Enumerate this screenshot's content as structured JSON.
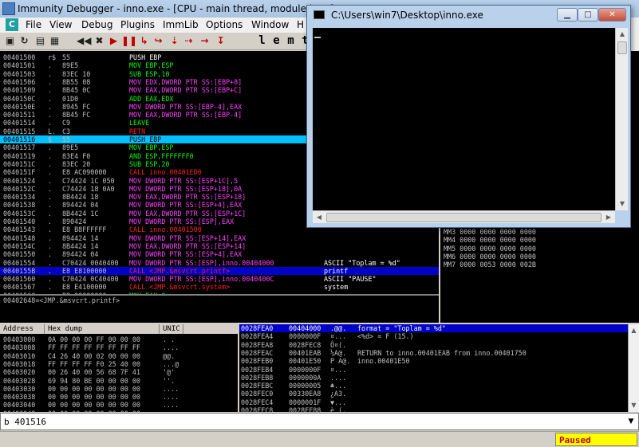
{
  "main_window": {
    "title": "Immunity Debugger - inno.exe - [CPU - main thread, module inno]",
    "menu": [
      "File",
      "View",
      "Debug",
      "Plugins",
      "ImmLib",
      "Options",
      "Window",
      "H"
    ],
    "menu_icon_letter": "C",
    "toolbar_letters": [
      "l",
      "e",
      "m",
      "t"
    ]
  },
  "disassembly": [
    {
      "addr": "00401500",
      "br": "r$",
      "hex": "55",
      "dis": "PUSH EBP",
      "com": "",
      "style": "white"
    },
    {
      "addr": "00401501",
      "br": ".",
      "hex": "89E5",
      "dis": "MOV EBP,ESP",
      "com": "",
      "style": "green"
    },
    {
      "addr": "00401503",
      "br": ".",
      "hex": "83EC 10",
      "dis": "SUB ESP,10",
      "com": "",
      "style": "green"
    },
    {
      "addr": "00401506",
      "br": ".",
      "hex": "8B55 08",
      "dis": "MOV EDX,DWORD PTR SS:[EBP+8]",
      "com": "",
      "style": "mem"
    },
    {
      "addr": "00401509",
      "br": ".",
      "hex": "8B45 0C",
      "dis": "MOV EAX,DWORD PTR SS:[EBP+C]",
      "com": "",
      "style": "mem"
    },
    {
      "addr": "0040150C",
      "br": ".",
      "hex": "01D0",
      "dis": "ADD EAX,EDX",
      "com": "",
      "style": "green"
    },
    {
      "addr": "0040150E",
      "br": ".",
      "hex": "8945 FC",
      "dis": "MOV DWORD PTR SS:[EBP-4],EAX",
      "com": "",
      "style": "mem"
    },
    {
      "addr": "00401511",
      "br": ".",
      "hex": "8B45 FC",
      "dis": "MOV EAX,DWORD PTR SS:[EBP-4]",
      "com": "",
      "style": "mem"
    },
    {
      "addr": "00401514",
      "br": ".",
      "hex": "C9",
      "dis": "LEAVE",
      "com": "",
      "style": "green"
    },
    {
      "addr": "00401515",
      "br": "L.",
      "hex": "C3",
      "dis": "RETN",
      "com": "",
      "style": "red"
    },
    {
      "addr": "00401516",
      "br": "$",
      "hex": "55",
      "dis": "PUSH EBP",
      "com": "",
      "style": "white",
      "hl": "cyan"
    },
    {
      "addr": "00401517",
      "br": ".",
      "hex": "89E5",
      "dis": "MOV EBP,ESP",
      "com": "",
      "style": "green"
    },
    {
      "addr": "00401519",
      "br": ".",
      "hex": "83E4 F0",
      "dis": "AND ESP,FFFFFFF0",
      "com": "",
      "style": "green"
    },
    {
      "addr": "0040151C",
      "br": ".",
      "hex": "83EC 20",
      "dis": "SUB ESP,20",
      "com": "",
      "style": "green"
    },
    {
      "addr": "0040151F",
      "br": ".",
      "hex": "E8 AC090000",
      "dis": "CALL inno.00401ED0",
      "com": "",
      "style": "red"
    },
    {
      "addr": "00401524",
      "br": ".",
      "hex": "C74424 1C 050",
      "dis": "MOV DWORD PTR SS:[ESP+1C],5",
      "com": "",
      "style": "mem"
    },
    {
      "addr": "0040152C",
      "br": ".",
      "hex": "C74424 18 0A0",
      "dis": "MOV DWORD PTR SS:[ESP+18],0A",
      "com": "",
      "style": "mem"
    },
    {
      "addr": "00401534",
      "br": ".",
      "hex": "8B4424 18",
      "dis": "MOV EAX,DWORD PTR SS:[ESP+18]",
      "com": "",
      "style": "mem"
    },
    {
      "addr": "00401538",
      "br": ".",
      "hex": "894424 04",
      "dis": "MOV DWORD PTR SS:[ESP+4],EAX",
      "com": "",
      "style": "mem"
    },
    {
      "addr": "0040153C",
      "br": ".",
      "hex": "8B4424 1C",
      "dis": "MOV EAX,DWORD PTR SS:[ESP+1C]",
      "com": "",
      "style": "mem"
    },
    {
      "addr": "00401540",
      "br": ".",
      "hex": "890424",
      "dis": "MOV DWORD PTR SS:[ESP],EAX",
      "com": "",
      "style": "mem"
    },
    {
      "addr": "00401543",
      "br": ".",
      "hex": "E8 B8FFFFFF",
      "dis": "CALL inno.00401500",
      "com": "",
      "style": "red"
    },
    {
      "addr": "00401548",
      "br": ".",
      "hex": "894424 14",
      "dis": "MOV DWORD PTR SS:[ESP+14],EAX",
      "com": "",
      "style": "mem"
    },
    {
      "addr": "0040154C",
      "br": ".",
      "hex": "8B4424 14",
      "dis": "MOV EAX,DWORD PTR SS:[ESP+14]",
      "com": "",
      "style": "mem"
    },
    {
      "addr": "00401550",
      "br": ".",
      "hex": "894424 04",
      "dis": "MOV DWORD PTR SS:[ESP+4],EAX",
      "com": "",
      "style": "mem"
    },
    {
      "addr": "00401554",
      "br": ".",
      "hex": "C70424 0040400",
      "dis": "MOV DWORD PTR SS:[ESP],inno.00404000",
      "com": "ASCII \"Toplam = %d\"",
      "style": "mem"
    },
    {
      "addr": "0040155B",
      "br": ".",
      "hex": "E8 E8100000",
      "dis": "CALL <JMP.&msvcrt.printf>",
      "com": "printf",
      "style": "red",
      "hl": "blue"
    },
    {
      "addr": "00401560",
      "br": ".",
      "hex": "C70424 0C40400",
      "dis": "MOV DWORD PTR SS:[ESP],inno.0040400C",
      "com": "ASCII \"PAUSE\"",
      "style": "mem"
    },
    {
      "addr": "00401567",
      "br": ".",
      "hex": "E8 E4100000",
      "dis": "CALL <JMP.&msvcrt.system>",
      "com": "system",
      "style": "red"
    },
    {
      "addr": "0040156C",
      "br": ".",
      "hex": "B8 00000000",
      "dis": "MOV EAX,0",
      "com": "",
      "style": "green"
    },
    {
      "addr": "00401571",
      "br": ".",
      "hex": "C9",
      "dis": "LEAVE",
      "com": "",
      "style": "green"
    },
    {
      "addr": "00401572",
      "br": ".",
      "hex": "C3",
      "dis": "RETN",
      "com": "",
      "style": "red"
    },
    {
      "addr": "00401573",
      "br": "",
      "hex": "90",
      "dis": "NOP",
      "com": "",
      "style": "green"
    },
    {
      "addr": "00401574",
      "br": "",
      "hex": "90",
      "dis": "NOP",
      "com": "",
      "style": "green"
    }
  ],
  "info_line": "00402648=<JMP.&msvcrt.printf>",
  "registers": [
    "MM3 0000 0000 0000 0000",
    "MM4 0000 0000 0000 0000",
    "MM5 0000 0000 0000 0000",
    "MM6 0000 0000 0000 0000",
    "MM7 0000 0053 0000 002B"
  ],
  "dump": {
    "headers": [
      "Address",
      "Hex dump",
      "UNIC"
    ],
    "rows": [
      {
        "addr": "00403000",
        "hex": "0A 00 00 00 FF 00 00 00",
        "txt": ". ."
      },
      {
        "addr": "00403008",
        "hex": "FF FF FF FF FF FF FF FF",
        "txt": "...."
      },
      {
        "addr": "00403010",
        "hex": "C4 26 40 00 02 00 00 00",
        "txt": "@@."
      },
      {
        "addr": "00403018",
        "hex": "FF FF FF FF F0 25 40 00",
        "txt": "...@"
      },
      {
        "addr": "00403020",
        "hex": "00 26 40 00 56 68 7F 41",
        "txt": "'@'"
      },
      {
        "addr": "00403028",
        "hex": "69 94 80 BE 00 00 00 00",
        "txt": "''."
      },
      {
        "addr": "00403030",
        "hex": "00 00 00 00 00 00 00 00",
        "txt": "...."
      },
      {
        "addr": "00403038",
        "hex": "00 00 00 00 00 00 00 00",
        "txt": "...."
      },
      {
        "addr": "00403040",
        "hex": "00 00 00 00 00 00 00 00",
        "txt": "...."
      },
      {
        "addr": "00403048",
        "hex": "00 00 00 00 00 00 00 00",
        "txt": "...."
      }
    ]
  },
  "stack": [
    {
      "addr": "0028FEA0",
      "val": "00404000",
      "asc": ".@@.",
      "com": "format = \"Toplam = %d\"",
      "hl": true
    },
    {
      "addr": "0028FEA4",
      "val": "0000000F",
      "asc": "¤...",
      "com": "<%d> = F (15.)"
    },
    {
      "addr": "0028FEA8",
      "val": "0028FEC8",
      "asc": "Ô¤(.",
      "com": ""
    },
    {
      "addr": "0028FEAC",
      "val": "00401EAB",
      "asc": "½A@.",
      "com": "RETURN to inno.00401EAB from inno.00401750"
    },
    {
      "addr": "0028FEB0",
      "val": "00401E50",
      "asc": "P A@.",
      "com": "inno.00401E50"
    },
    {
      "addr": "0028FEB4",
      "val": "0000000F",
      "asc": "¤...",
      "com": ""
    },
    {
      "addr": "0028FEB8",
      "val": "0000000A",
      "asc": "....",
      "com": ""
    },
    {
      "addr": "0028FEBC",
      "val": "00000005",
      "asc": "♣...",
      "com": ""
    },
    {
      "addr": "0028FEC0",
      "val": "00330EA8",
      "asc": "¿A3.",
      "com": ""
    },
    {
      "addr": "0028FEC4",
      "val": "0000001F",
      "asc": "▼...",
      "com": ""
    },
    {
      "addr": "0028FEC8",
      "val": "0028FF88",
      "asc": "è (.",
      "com": ""
    },
    {
      "addr": "0028FECC",
      "val": "004013E2",
      "asc": "Γ!@.",
      "com": "RETURN to inno.004013E2 from inno.00401516"
    }
  ],
  "command_line": "b 401516",
  "status": "Paused",
  "console": {
    "title": "C:\\Users\\win7\\Desktop\\inno.exe"
  },
  "colors": {
    "green": "#00ff00",
    "red": "#ff2020",
    "mem": "#ff40ff",
    "white": "#ffffff",
    "cyan_hl": "#00c0ff",
    "blue_hl": "#0000c8"
  }
}
